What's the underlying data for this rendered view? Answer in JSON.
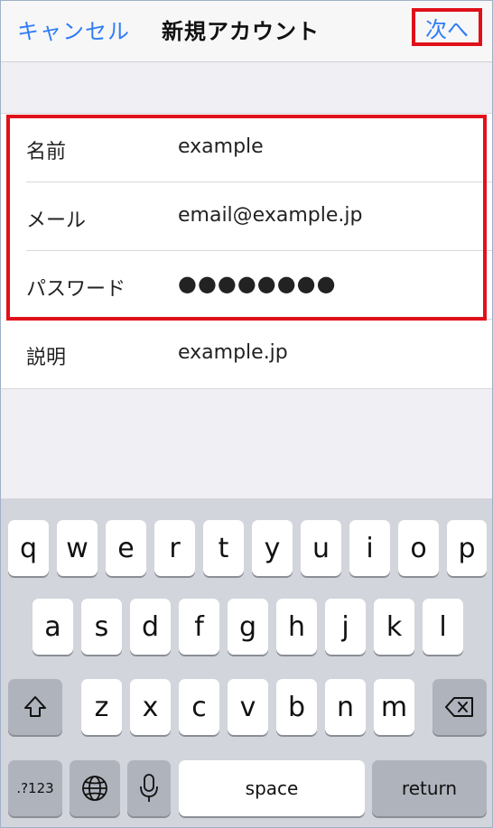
{
  "navbar": {
    "cancel_label": "キャンセル",
    "title": "新規アカウント",
    "next_label": "次へ"
  },
  "form": {
    "rows": [
      {
        "label": "名前",
        "value": "example"
      },
      {
        "label": "メール",
        "value": "email@example.jp"
      },
      {
        "label": "パスワード",
        "value": "●●●●●●●●"
      },
      {
        "label": "説明",
        "value": "example.jp"
      }
    ]
  },
  "keyboard": {
    "row1": [
      "q",
      "w",
      "e",
      "r",
      "t",
      "y",
      "u",
      "i",
      "o",
      "p"
    ],
    "row2": [
      "a",
      "s",
      "d",
      "f",
      "g",
      "h",
      "j",
      "k",
      "l"
    ],
    "row3": [
      "z",
      "x",
      "c",
      "v",
      "b",
      "n",
      "m"
    ],
    "numbers_label": ".?123",
    "space_label": "space",
    "return_label": "return",
    "icons": {
      "shift": "shift-icon",
      "delete": "backspace-icon",
      "globe": "globe-icon",
      "mic": "microphone-icon"
    }
  },
  "colors": {
    "accent": "#2f7cf6",
    "highlight": "#e0101a",
    "keyboard_bg": "#d2d5db",
    "dark_key": "#aeb3bc"
  }
}
